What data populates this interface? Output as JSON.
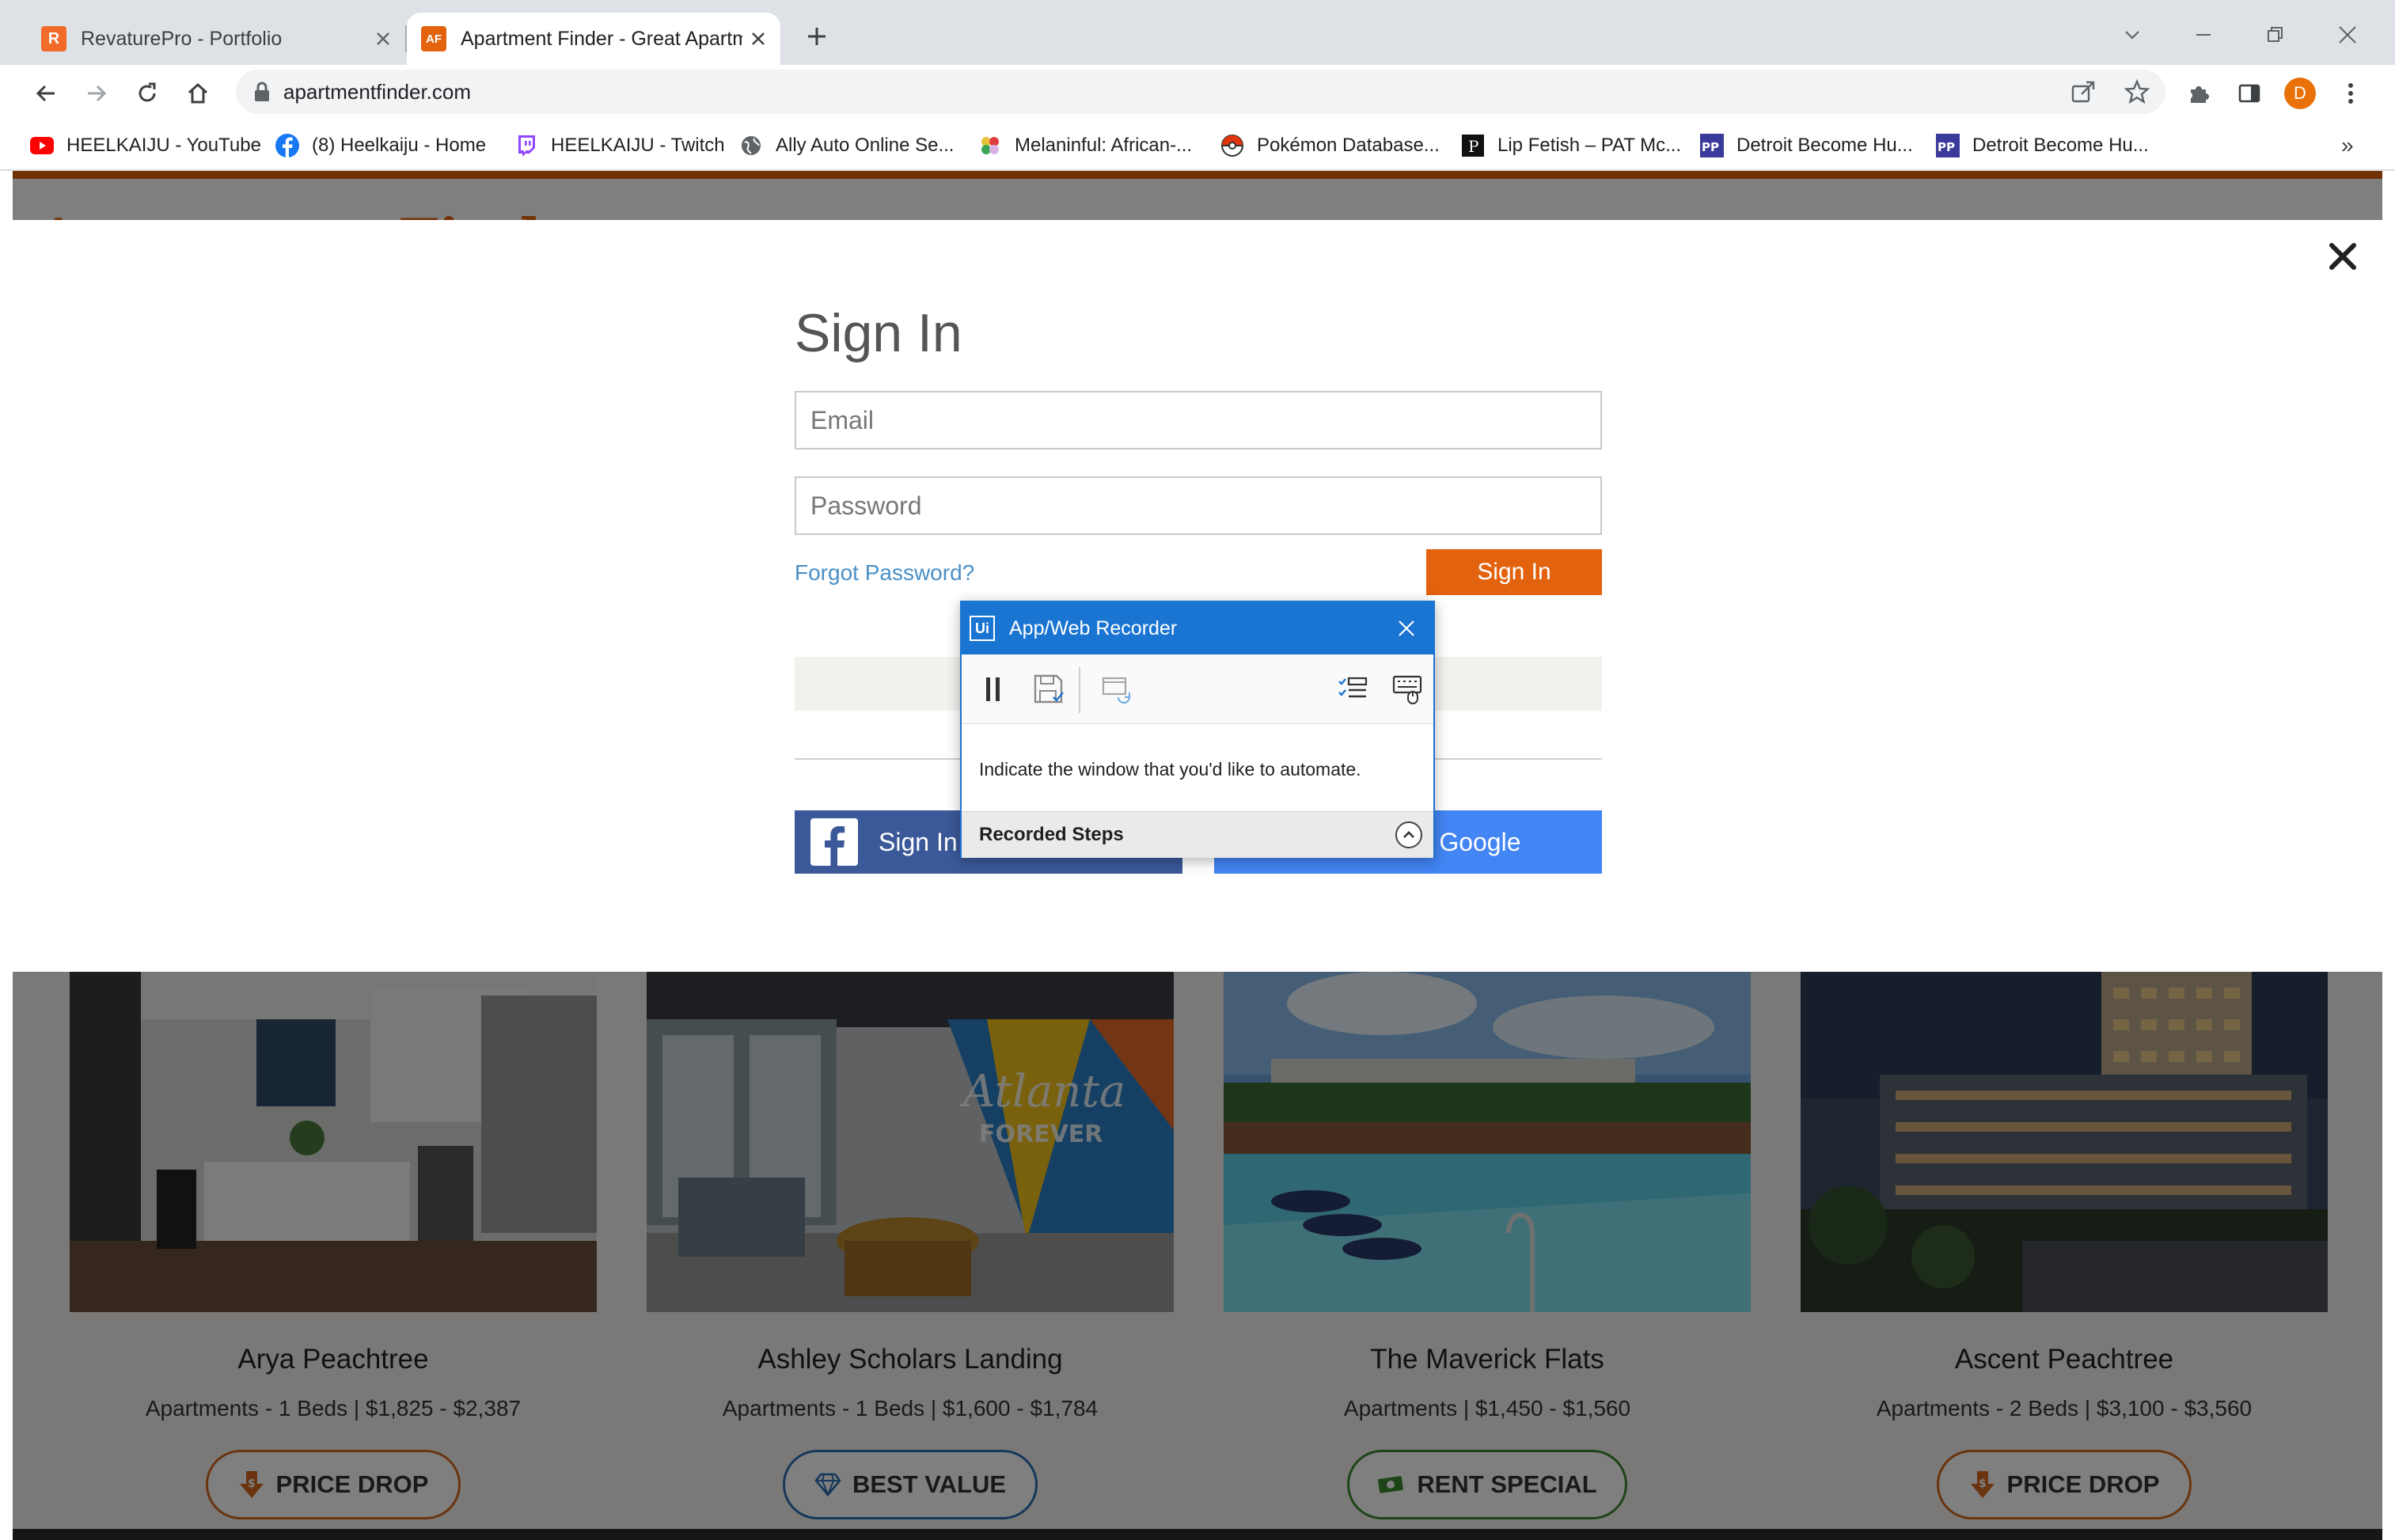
{
  "tabs": [
    {
      "title": "RevaturePro - Portfolio",
      "favicon_text": "R",
      "favicon_color": "#f26b2a",
      "active": false
    },
    {
      "title": "Apartment Finder - Great Apartm",
      "favicon_text": "AF",
      "favicon_color": "#e2620d",
      "active": true
    }
  ],
  "address_bar": {
    "url": "apartmentfinder.com"
  },
  "profile": {
    "initial": "D",
    "color": "#e8710a"
  },
  "bookmarks": [
    {
      "label": "HEELKAIJU - YouTube",
      "icon": "youtube-icon"
    },
    {
      "label": "(8) Heelkaiju - Home",
      "icon": "facebook-icon"
    },
    {
      "label": "HEELKAIJU - Twitch",
      "icon": "twitch-icon"
    },
    {
      "label": "Ally Auto Online Se...",
      "icon": "globe-icon"
    },
    {
      "label": "Melaninful: African-...",
      "icon": "flower-icon"
    },
    {
      "label": "Pokémon Database...",
      "icon": "pokeball-icon"
    },
    {
      "label": "Lip Fetish – PAT Mc...",
      "icon": "p-icon"
    },
    {
      "label": "Detroit Become Hu...",
      "icon": "pp-icon"
    },
    {
      "label": "Detroit Become Hu...",
      "icon": "pp-icon"
    }
  ],
  "bookmarks_more": "»",
  "site": {
    "logo_text": "Apartment Finder",
    "brand_color": "#e2620d"
  },
  "signin": {
    "title": "Sign In",
    "email_placeholder": "Email",
    "password_placeholder": "Password",
    "forgot_label": "Forgot Password?",
    "submit_label": "Sign In",
    "facebook_label": "Sign In with Facebook",
    "google_label": "Sign In with Google"
  },
  "recorder": {
    "title": "App/Web Recorder",
    "logo_text": "Ui",
    "message": "Indicate the window that you'd like to automate.",
    "steps_label": "Recorded Steps"
  },
  "listings": [
    {
      "name": "Arya Peachtree",
      "info": "Apartments - 1 Beds | $1,825 - $2,387",
      "badge": "PRICE DROP",
      "badge_color": "#d2691e"
    },
    {
      "name": "Ashley Scholars Landing",
      "info": "Apartments - 1 Beds | $1,600 - $1,784",
      "badge": "BEST VALUE",
      "badge_color": "#2a6fb5"
    },
    {
      "name": "The Maverick Flats",
      "info": "Apartments | $1,450 - $1,560",
      "badge": "RENT SPECIAL",
      "badge_color": "#3d8a2e"
    },
    {
      "name": "Ascent Peachtree",
      "info": "Apartments - 2 Beds | $3,100 - $3,560",
      "badge": "PRICE DROP",
      "badge_color": "#d2691e"
    }
  ]
}
